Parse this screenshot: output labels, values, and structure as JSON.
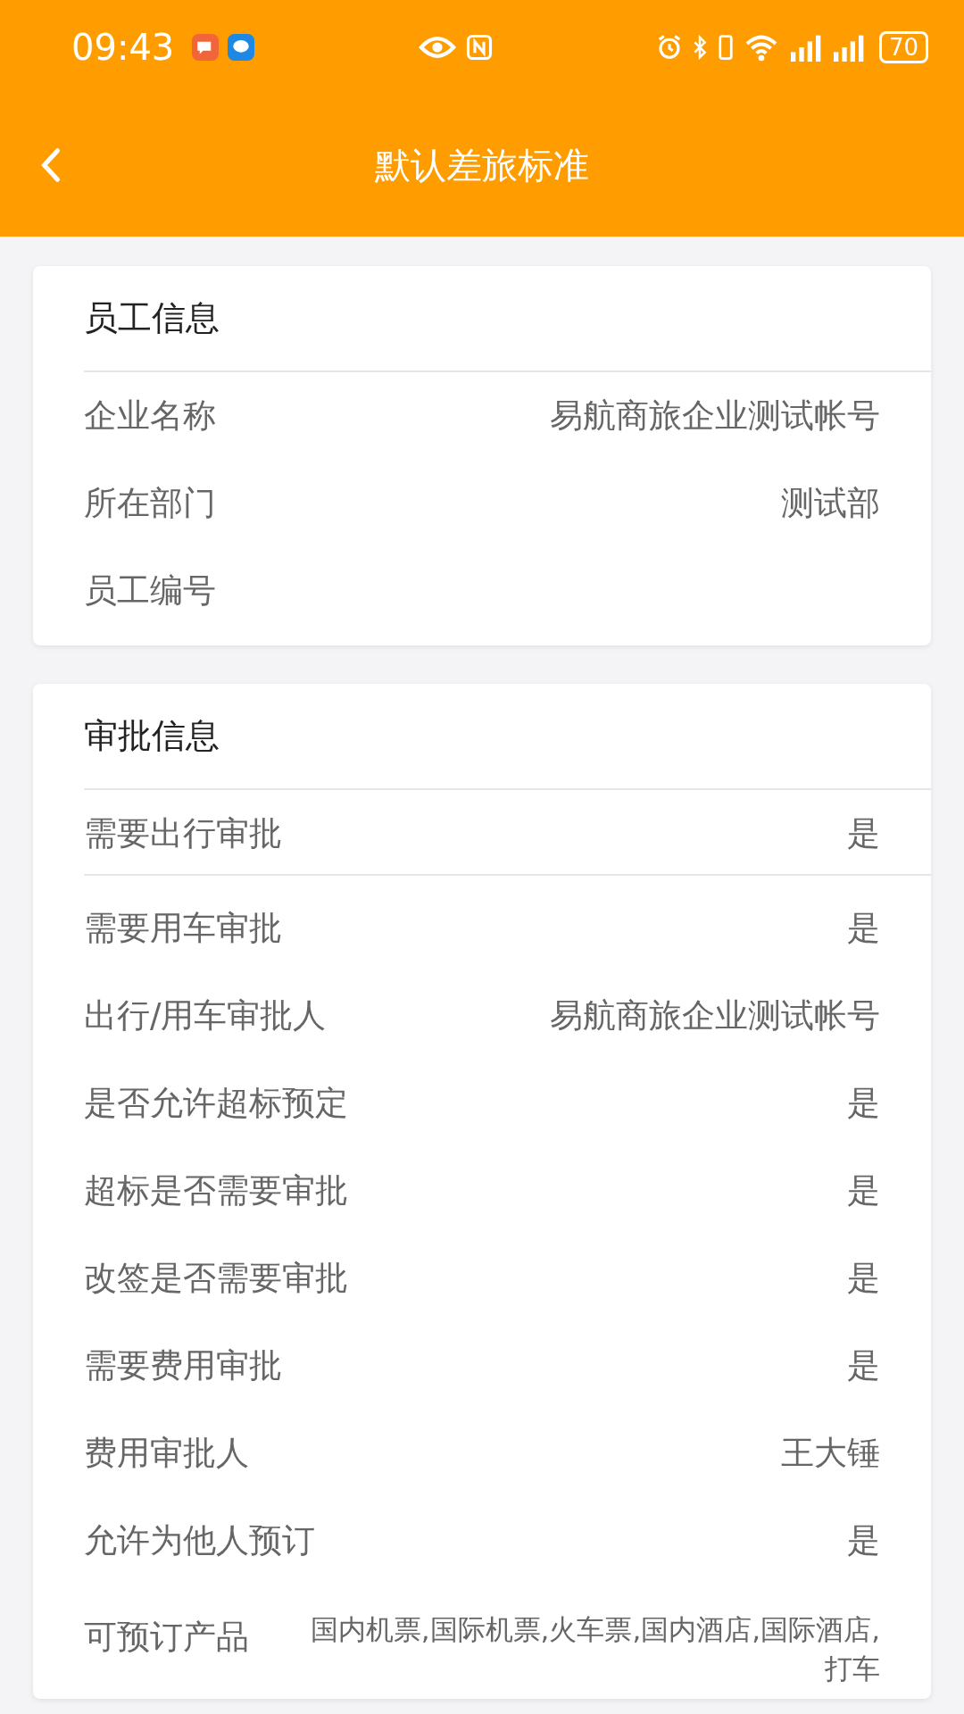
{
  "status_bar": {
    "time": "09:43",
    "battery": "70"
  },
  "header": {
    "title": "默认差旅标准"
  },
  "sections": [
    {
      "title": "员工信息",
      "groups": [
        [
          {
            "label": "企业名称",
            "value": "易航商旅企业测试帐号"
          },
          {
            "label": "所在部门",
            "value": "测试部"
          },
          {
            "label": "员工编号"
          }
        ]
      ]
    },
    {
      "title": "审批信息",
      "groups": [
        [
          {
            "label": "需要出行审批",
            "value": "是"
          }
        ],
        [
          {
            "label": "需要用车审批",
            "value": "是"
          },
          {
            "label": "出行/用车审批人",
            "value": "易航商旅企业测试帐号"
          },
          {
            "label": "是否允许超标预定",
            "value": "是"
          },
          {
            "label": "超标是否需要审批",
            "value": "是"
          },
          {
            "label": "改签是否需要审批",
            "value": "是"
          },
          {
            "label": "需要费用审批",
            "value": "是"
          },
          {
            "label": "费用审批人",
            "value": "王大锤"
          },
          {
            "label": "允许为他人预订",
            "value": "是"
          },
          {
            "label": "可预订产品",
            "value": "国内机票,国际机票,火车票,国内酒店,国际酒店,打车",
            "kind": "long"
          }
        ]
      ]
    }
  ]
}
